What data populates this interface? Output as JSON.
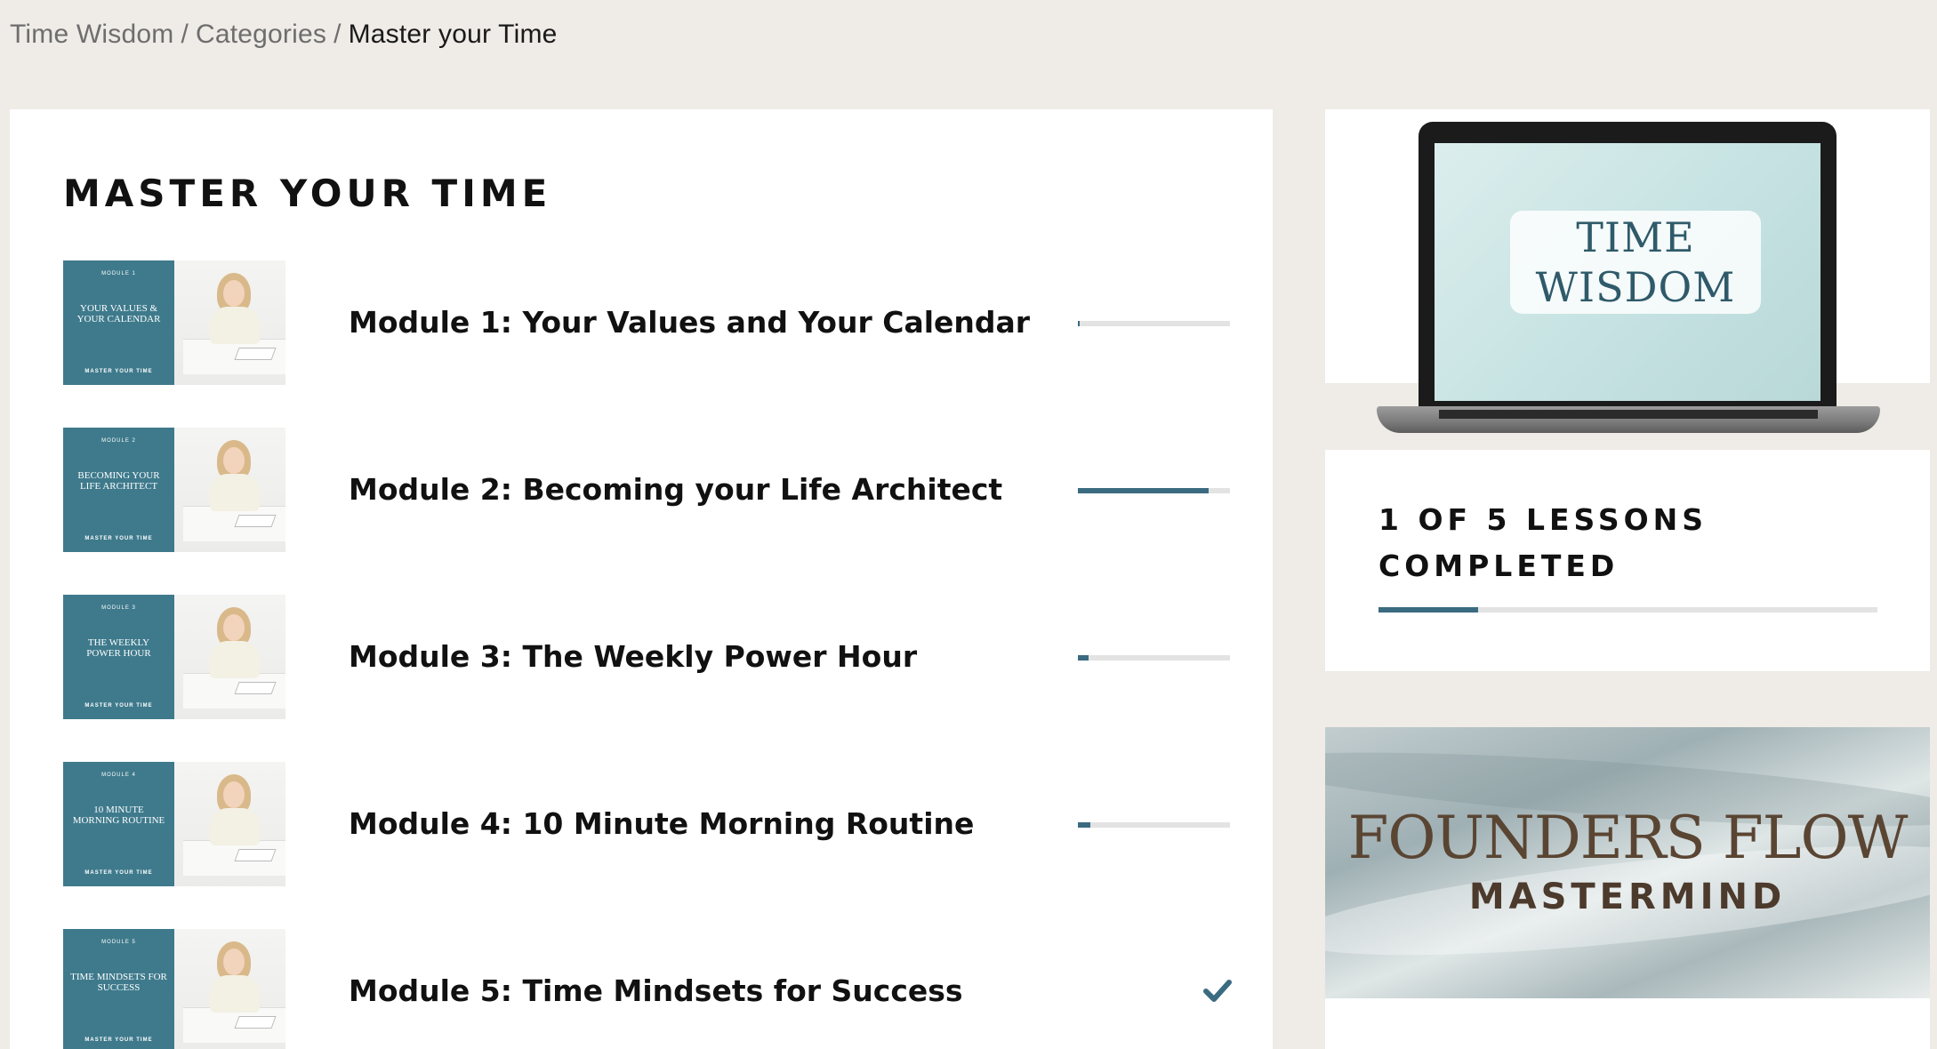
{
  "breadcrumb": {
    "items": [
      "Time Wisdom",
      "Categories"
    ],
    "separator": "/",
    "current": "Master your Time"
  },
  "page": {
    "title": "MASTER YOUR TIME"
  },
  "modules": [
    {
      "title": "Module 1: Your Values and Your Calendar",
      "cover_label": "MODULE 1",
      "cover_text": "YOUR VALUES & YOUR CALENDAR",
      "cover_footer": "MASTER YOUR TIME",
      "progress": 0.01,
      "completed": false
    },
    {
      "title": "Module 2: Becoming your Life Architect",
      "cover_label": "MODULE 2",
      "cover_text": "BECOMING YOUR LIFE ARCHITECT",
      "cover_footer": "MASTER YOUR TIME",
      "progress": 0.86,
      "completed": false
    },
    {
      "title": "Module 3: The Weekly Power Hour",
      "cover_label": "MODULE 3",
      "cover_text": "THE WEEKLY POWER HOUR",
      "cover_footer": "MASTER YOUR TIME",
      "progress": 0.07,
      "completed": false
    },
    {
      "title": "Module 4: 10 Minute Morning Routine",
      "cover_label": "MODULE 4",
      "cover_text": "10 MINUTE MORNING ROUTINE",
      "cover_footer": "MASTER YOUR TIME",
      "progress": 0.08,
      "completed": false
    },
    {
      "title": "Module 5: Time Mindsets for Success",
      "cover_label": "MODULE 5",
      "cover_text": "TIME MINDSETS FOR SUCCESS",
      "cover_footer": "MASTER YOUR TIME",
      "progress": 1.0,
      "completed": true,
      "status_icon": "checkmark-icon"
    }
  ],
  "sidebar": {
    "course_image_text": [
      "TIME",
      "WISDOM"
    ],
    "lessons_completed": "1 OF 5 LESSONS COMPLETED",
    "lessons_done": 1,
    "lessons_total": 5,
    "ad": {
      "title": "FOUNDERS FLOW",
      "subtitle": "MASTERMIND"
    }
  },
  "colors": {
    "background": "#efebe6",
    "accent": "#3b6b80",
    "cover": "#3e7a8c",
    "track": "#e3e3e3"
  }
}
